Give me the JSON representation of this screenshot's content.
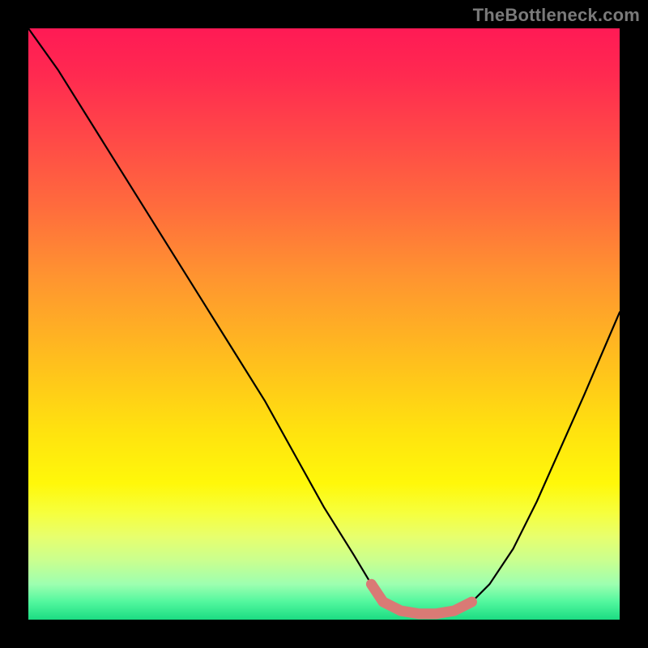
{
  "watermark": {
    "text": "TheBottleneck.com"
  },
  "colors": {
    "curve_stroke": "#000000",
    "highlight_stroke": "#d97a75",
    "background_black": "#000000"
  },
  "chart_data": {
    "type": "line",
    "title": "",
    "xlabel": "",
    "ylabel": "",
    "xlim": [
      0,
      100
    ],
    "ylim": [
      0,
      100
    ],
    "series": [
      {
        "name": "bottleneck-curve",
        "x": [
          0,
          5,
          10,
          15,
          20,
          25,
          30,
          35,
          40,
          45,
          50,
          55,
          58,
          60,
          63,
          66,
          69,
          72,
          75,
          78,
          82,
          86,
          90,
          94,
          100
        ],
        "values": [
          100,
          93,
          85,
          77,
          69,
          61,
          53,
          45,
          37,
          28,
          19,
          11,
          6,
          3,
          1.5,
          1,
          1,
          1.5,
          3,
          6,
          12,
          20,
          29,
          38,
          52
        ]
      },
      {
        "name": "optimal-range-highlight",
        "x": [
          58,
          60,
          63,
          66,
          69,
          72,
          75
        ],
        "values": [
          6,
          3,
          1.5,
          1,
          1,
          1.5,
          3
        ]
      }
    ],
    "annotations": [
      {
        "text": "TheBottleneck.com",
        "role": "watermark",
        "position": "top-right"
      }
    ]
  }
}
